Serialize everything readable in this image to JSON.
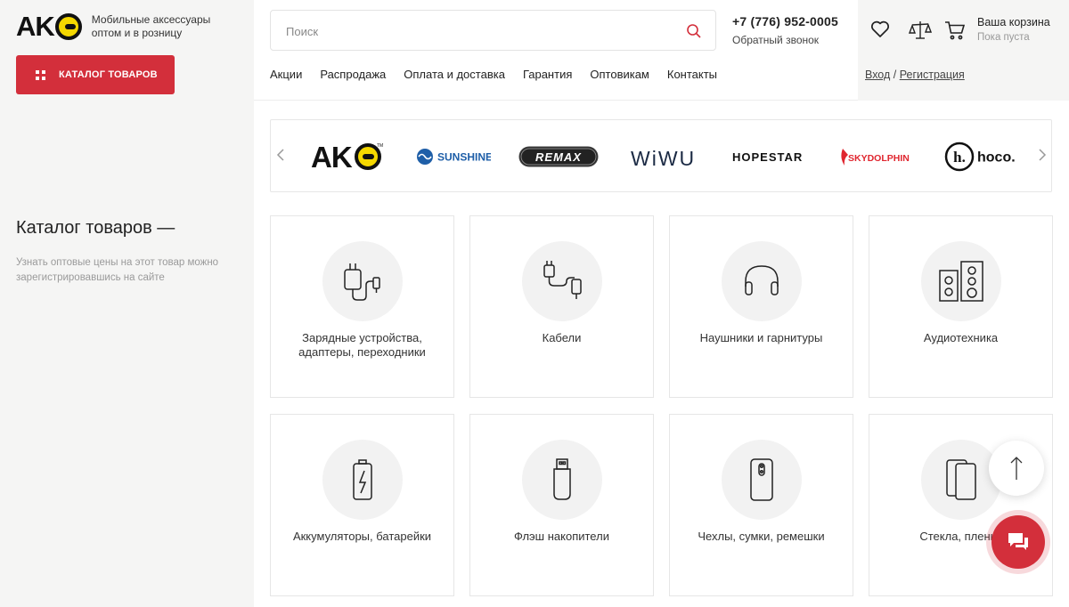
{
  "logo": {
    "tagline_line1": "Мобильные аксессуары",
    "tagline_line2": "оптом и в розницу",
    "brand_color": "#f5d800"
  },
  "sidebar": {
    "catalog_button": "КАТАЛОГ ТОВАРОВ",
    "title": "Каталог товаров —",
    "description": "Узнать оптовые цены на этот товар можно зарегистрировавшись на сайте"
  },
  "search": {
    "placeholder": "Поиск",
    "value": ""
  },
  "nav": {
    "items": [
      "Акции",
      "Распродажа",
      "Оплата и доставка",
      "Гарантия",
      "Оптовикам",
      "Контакты"
    ]
  },
  "contacts": {
    "phone": "+7 (776) 952-0005",
    "callback": "Обратный звонок"
  },
  "header_icons": [
    "heart-icon",
    "compare-scales-icon",
    "cart-icon"
  ],
  "cart": {
    "title": "Ваша корзина",
    "status": "Пока пуста"
  },
  "auth": {
    "login": "Вход",
    "separator": " / ",
    "register": "Регистрация"
  },
  "brands": [
    "AKC",
    "SUNSHINE",
    "REMAX",
    "WiWU",
    "HOPESTAR",
    "SKYDOLPHIN",
    "hoco."
  ],
  "categories": [
    {
      "label": "Зарядные устройства, адаптеры, переходники",
      "icon": "charger-icon"
    },
    {
      "label": "Кабели",
      "icon": "cable-icon"
    },
    {
      "label": "Наушники и гарнитуры",
      "icon": "headphones-icon"
    },
    {
      "label": "Аудиотехника",
      "icon": "speakers-icon"
    },
    {
      "label": "Аккумуляторы, батарейки",
      "icon": "battery-icon"
    },
    {
      "label": "Флэш накопители",
      "icon": "flash-drive-icon"
    },
    {
      "label": "Чехлы, сумки, ремешки",
      "icon": "phone-case-icon"
    },
    {
      "label": "Стекла, пленки",
      "icon": "screen-glass-icon"
    }
  ],
  "colors": {
    "accent": "#d32f3b",
    "sidebar_bg": "#f5f5f4"
  }
}
